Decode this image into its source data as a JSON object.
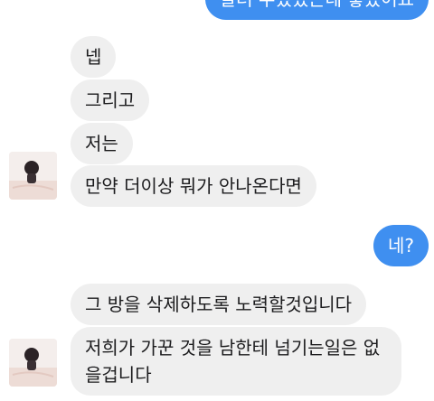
{
  "messages": [
    {
      "side": "out",
      "text": "알려 주셨었는데 좋았어요"
    },
    {
      "side": "in",
      "text": "넵"
    },
    {
      "side": "in",
      "text": "그리고"
    },
    {
      "side": "in",
      "text": "저는"
    },
    {
      "side": "in",
      "text": "만약 더이상 뭐가 안나온다면"
    },
    {
      "side": "out",
      "text": "네?"
    },
    {
      "side": "in",
      "text": "그 방을 삭제하도록 노력할것입니다"
    },
    {
      "side": "in",
      "text": "저희가 가꾼 것을 남한테 넘기는일은 없을겁니다"
    }
  ],
  "colors": {
    "outgoing_bubble": "#3f8ff0",
    "incoming_bubble": "#efefef",
    "incoming_text": "#1c1c1e",
    "outgoing_text": "#ffffff"
  }
}
